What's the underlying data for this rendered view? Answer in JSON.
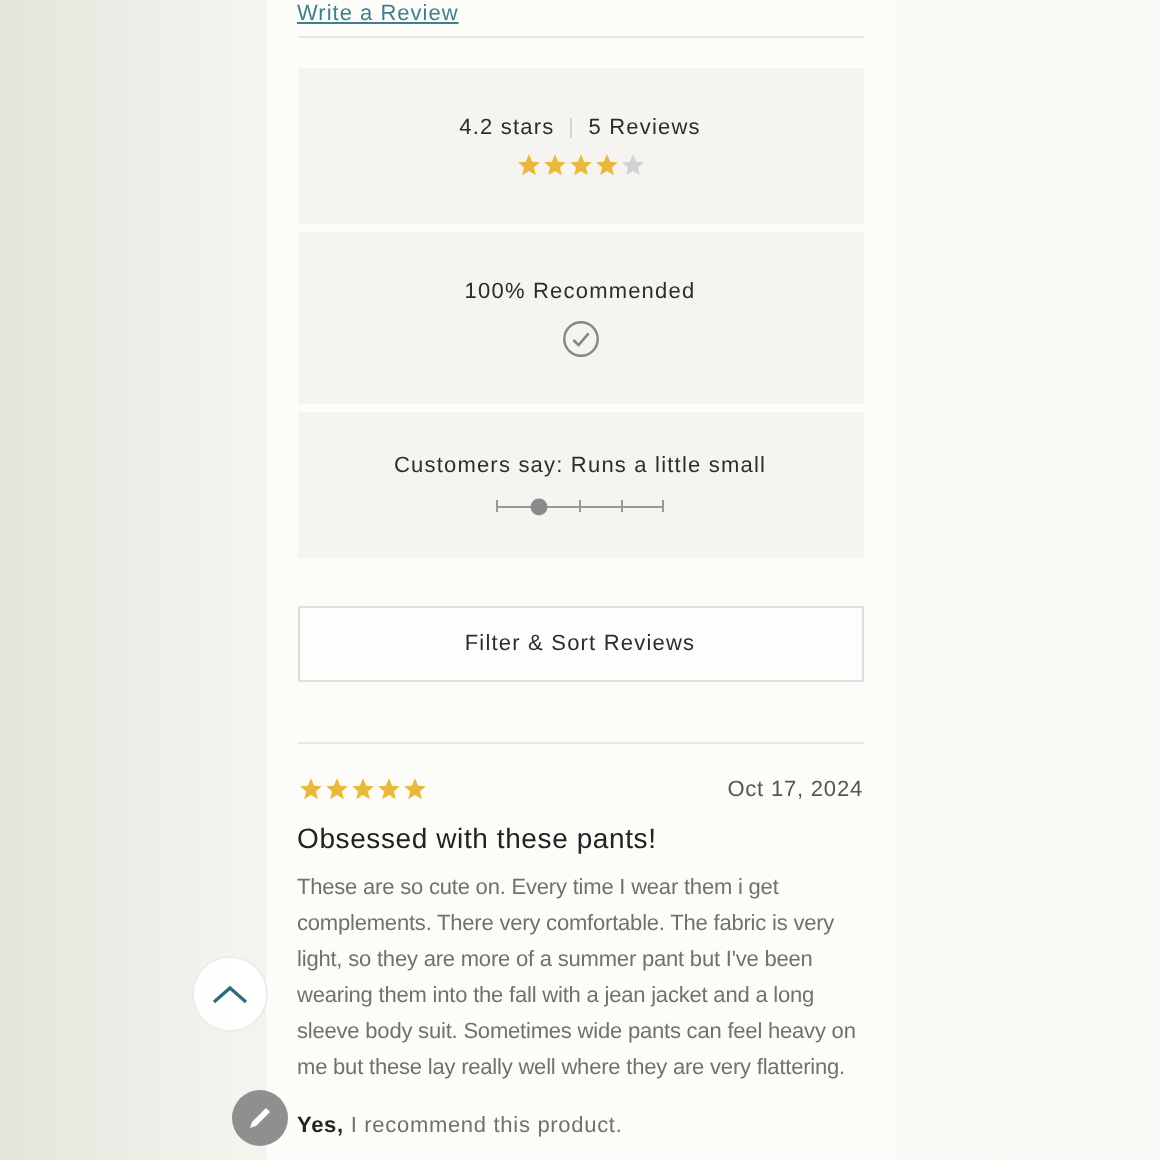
{
  "write_review_link": "Write a Review",
  "summary": {
    "rating": "4.2 stars",
    "review_count": "5 Reviews",
    "stars": 4
  },
  "recommended": {
    "label": "100% Recommended"
  },
  "fit": {
    "label": "Customers say: Runs a little small",
    "level": 0.25
  },
  "filter_button": "Filter & Sort Reviews",
  "review": {
    "stars": 5,
    "date": "Oct 17, 2024",
    "title": "Obsessed with these pants!",
    "body": "These are so cute on. Every time I wear them i get complements. There very comfortable. The fabric is very light, so they are more of a summer pant but I've been wearing them into the fall with a jean jacket and a long sleeve body suit. Sometimes wide pants can feel heavy on me but these lay really well where they are very flattering.",
    "recommend": "**Yes,** I recommend this product."
  }
}
